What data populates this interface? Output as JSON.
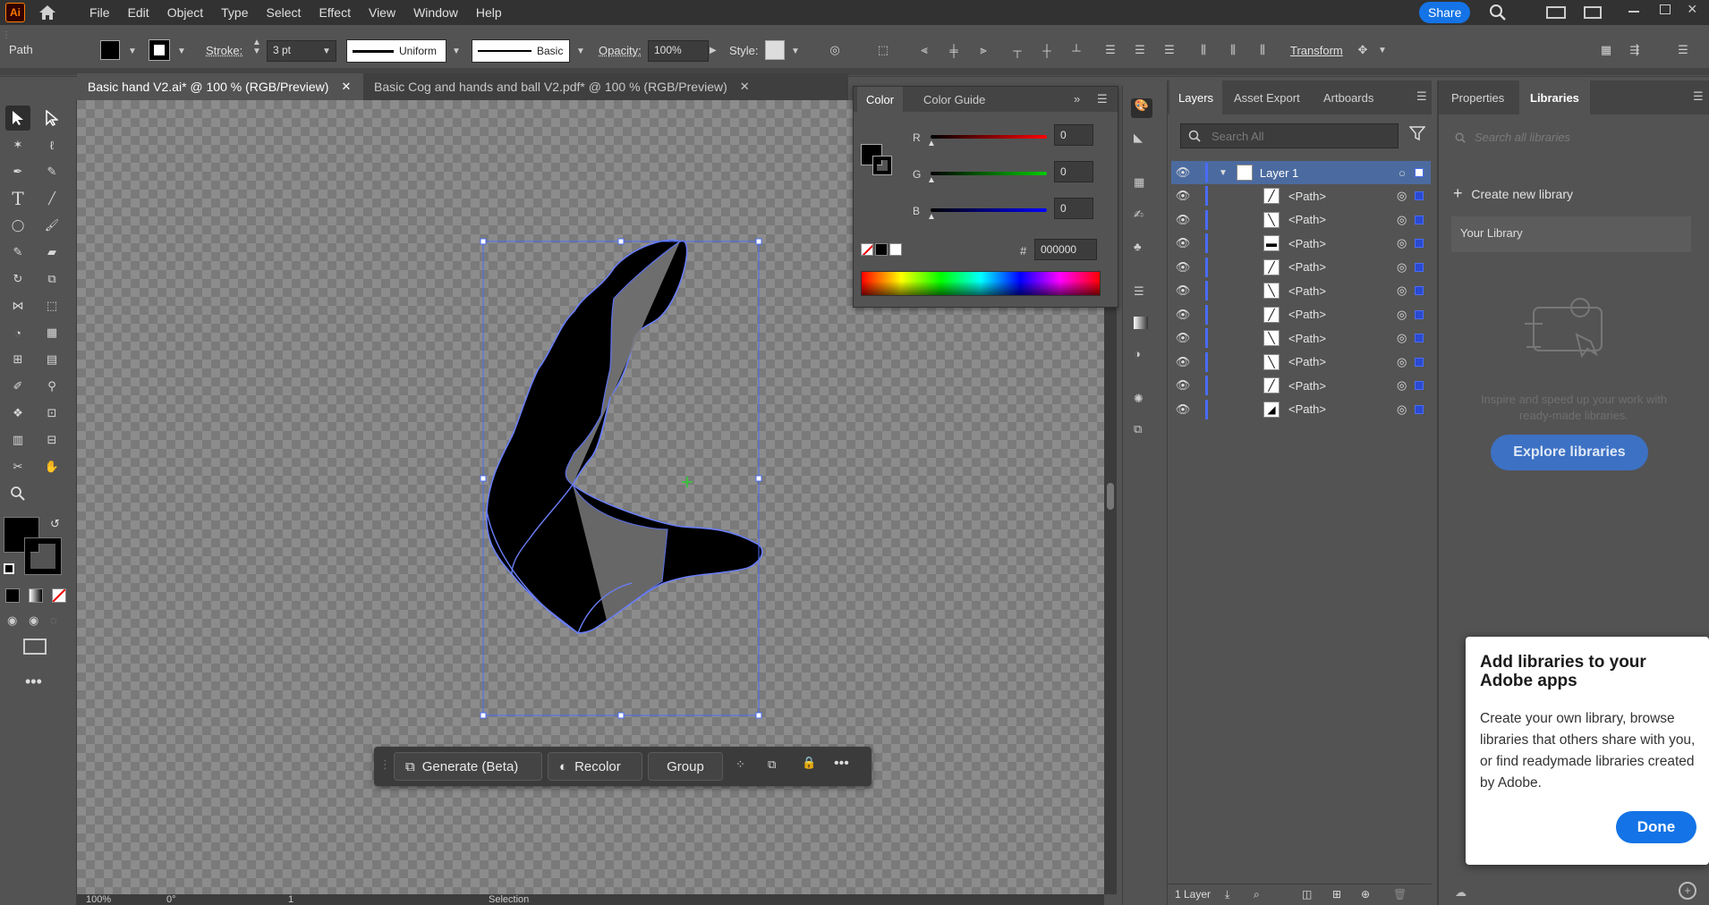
{
  "app": {
    "logo": "Ai"
  },
  "menu": [
    "File",
    "Edit",
    "Object",
    "Type",
    "Select",
    "Effect",
    "View",
    "Window",
    "Help"
  ],
  "share_label": "Share",
  "control": {
    "object_type": "Path",
    "stroke_label": "Stroke:",
    "stroke_value": "3 pt",
    "profile_label": "Uniform",
    "brush_label": "Basic",
    "opacity_label": "Opacity:",
    "opacity_value": "100%",
    "style_label": "Style:",
    "transform_label": "Transform"
  },
  "tabs": [
    {
      "label": "Basic hand V2.ai* @ 100 % (RGB/Preview)",
      "active": true
    },
    {
      "label": "Basic Cog and hands and ball V2.pdf* @ 100 % (RGB/Preview)",
      "active": false
    }
  ],
  "taskbar": {
    "generate": "Generate (Beta)",
    "recolor": "Recolor",
    "group": "Group"
  },
  "color_panel": {
    "tabs": [
      "Color",
      "Color Guide"
    ],
    "r_label": "R",
    "r_value": "0",
    "g_label": "G",
    "g_value": "0",
    "b_label": "B",
    "b_value": "0",
    "hex_symbol": "#",
    "hex_value": "000000"
  },
  "layers_panel": {
    "tabs": [
      "Layers",
      "Asset Export",
      "Artboards"
    ],
    "search_placeholder": "Search All",
    "layer_name": "Layer 1",
    "paths": [
      "<Path>",
      "<Path>",
      "<Path>",
      "<Path>",
      "<Path>",
      "<Path>",
      "<Path>",
      "<Path>",
      "<Path>",
      "<Path>"
    ],
    "footer": "1 Layer"
  },
  "libraries_panel": {
    "tabs": [
      "Properties",
      "Libraries"
    ],
    "search_placeholder": "Search all libraries",
    "create_label": "Create new library",
    "your_library": "Your Library",
    "inspire_text": "Inspire and speed up your work with ready-made libraries.",
    "explore_label": "Explore libraries"
  },
  "popup": {
    "title": "Add libraries to your Adobe apps",
    "body": "Create your own library, browse libraries that others share with you, or find readymade libraries created by Adobe.",
    "done_label": "Done"
  },
  "status": {
    "zoom": "100%",
    "rotation": "0°",
    "artboard": "1",
    "tool": "Selection"
  },
  "colors": {
    "accent": "#1473e6",
    "selection": "#4a6cf7",
    "panel_bg": "#535353",
    "menubar_bg": "#323232"
  }
}
